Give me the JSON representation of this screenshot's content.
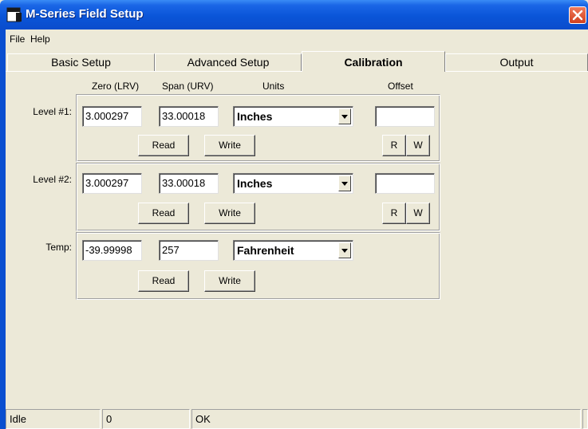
{
  "window": {
    "title": "M-Series Field Setup"
  },
  "menu": {
    "items": [
      "File",
      "Help"
    ]
  },
  "tabs": [
    {
      "label": "Basic Setup",
      "active": false
    },
    {
      "label": "Advanced Setup",
      "active": false
    },
    {
      "label": "Calibration",
      "active": true
    },
    {
      "label": "Output",
      "active": false
    }
  ],
  "columns": {
    "zero": "Zero (LRV)",
    "span": "Span (URV)",
    "units": "Units",
    "offset": "Offset"
  },
  "rows": [
    {
      "label": "Level #1:",
      "zero": "3.000297",
      "span": "33.00018",
      "units": "Inches",
      "offset": "",
      "read": "Read",
      "write": "Write",
      "r": "R",
      "w": "W"
    },
    {
      "label": "Level #2:",
      "zero": "3.000297",
      "span": "33.00018",
      "units": "Inches",
      "offset": "",
      "read": "Read",
      "write": "Write",
      "r": "R",
      "w": "W"
    },
    {
      "label": "Temp:",
      "zero": "-39.99998",
      "span": "257",
      "units": "Fahrenheit",
      "read": "Read",
      "write": "Write"
    }
  ],
  "status": {
    "state": "Idle",
    "count": "0",
    "message": "OK"
  },
  "colors": {
    "titlebar": "#0a55d8",
    "face": "#ece9d8",
    "close": "#d0401e"
  },
  "icons": {
    "app": "app-icon",
    "close": "close-icon",
    "dropdown": "chevron-down-icon"
  }
}
